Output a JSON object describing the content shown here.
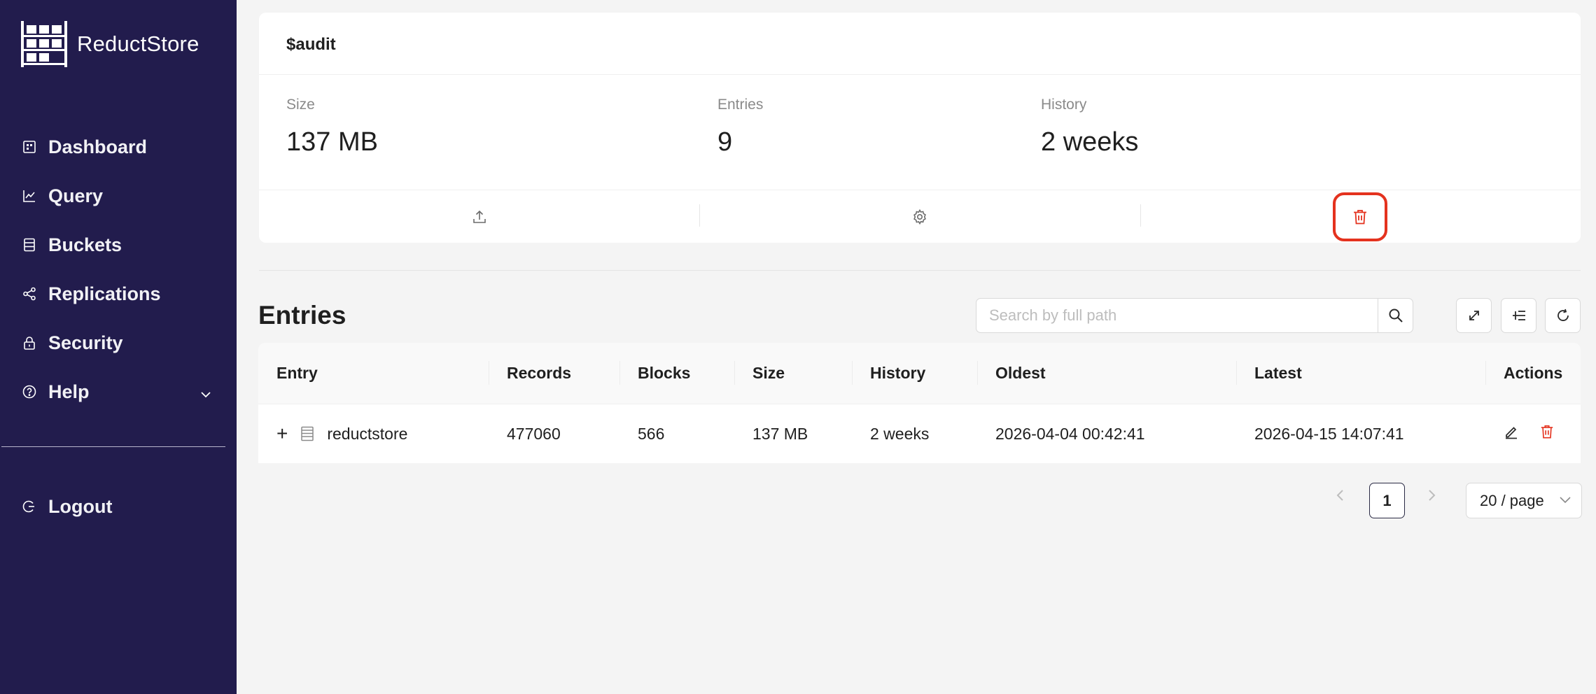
{
  "app": {
    "name": "ReductStore"
  },
  "sidebar": {
    "items": [
      {
        "label": "Dashboard",
        "icon": "dashboard-icon"
      },
      {
        "label": "Query",
        "icon": "chart-line-icon"
      },
      {
        "label": "Buckets",
        "icon": "database-icon"
      },
      {
        "label": "Replications",
        "icon": "share-icon"
      },
      {
        "label": "Security",
        "icon": "lock-icon"
      },
      {
        "label": "Help",
        "icon": "question-circle-icon"
      }
    ],
    "logout": "Logout"
  },
  "bucket": {
    "name": "$audit",
    "stats": [
      {
        "label": "Size",
        "value": "137 MB"
      },
      {
        "label": "Entries",
        "value": "9"
      },
      {
        "label": "History",
        "value": "2 weeks"
      }
    ],
    "actions": [
      "upload-icon",
      "settings-icon",
      "delete-icon"
    ],
    "accent_color": "#e4321e"
  },
  "entries": {
    "title": "Entries",
    "search_placeholder": "Search by full path",
    "columns": [
      "Entry",
      "Records",
      "Blocks",
      "Size",
      "History",
      "Oldest",
      "Latest",
      "Actions"
    ],
    "rows": [
      {
        "entry": "reductstore",
        "records": "477060",
        "blocks": "566",
        "size": "137 MB",
        "history": "2 weeks",
        "oldest": "2026-04-04 00:42:41",
        "latest": "2026-04-15 14:07:41"
      }
    ]
  },
  "pagination": {
    "current_page": "1",
    "page_size": "20 / page"
  },
  "colors": {
    "sidebar_bg": "#221c4d",
    "danger": "#e4321e"
  }
}
